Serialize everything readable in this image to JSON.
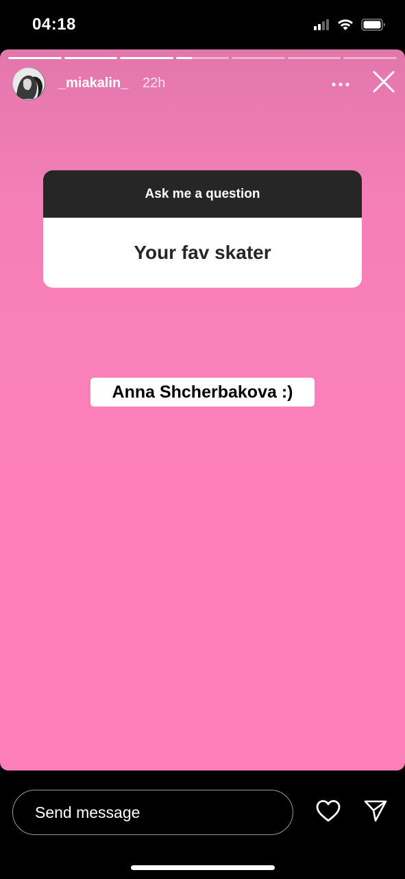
{
  "status_bar": {
    "time": "04:18",
    "icons": [
      "signal-icon",
      "wifi-icon",
      "battery-icon"
    ]
  },
  "story": {
    "progress": {
      "segments_total": 7,
      "segments_completed": 3,
      "current_segment_progress": 0.3
    },
    "user": {
      "username": "_miakalin_",
      "time_ago": "22h"
    },
    "header_icons": [
      "more-icon",
      "close-icon"
    ],
    "background_color": "#fd80ba",
    "question_sticker": {
      "prompt": "Ask me a question",
      "question": "Your fav skater"
    },
    "answer_text": "Anna Shcherbakova :)"
  },
  "bottom_bar": {
    "message_placeholder": "Send message",
    "icons": [
      "heart-icon",
      "send-icon"
    ]
  }
}
